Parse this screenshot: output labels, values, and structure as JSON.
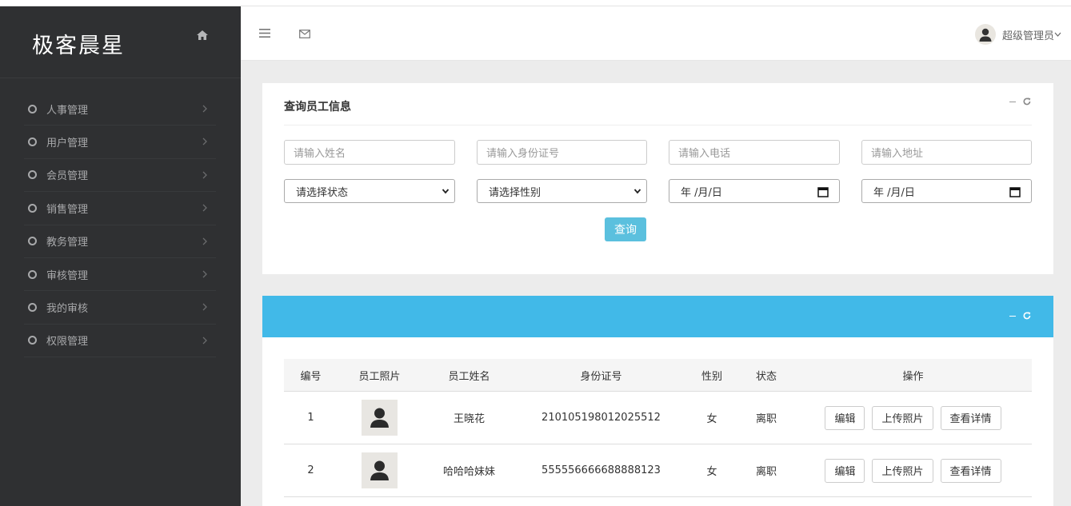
{
  "sidebar": {
    "logo": "极客晨星",
    "items": [
      {
        "label": "人事管理"
      },
      {
        "label": "用户管理"
      },
      {
        "label": "会员管理"
      },
      {
        "label": "销售管理"
      },
      {
        "label": "教务管理"
      },
      {
        "label": "审核管理"
      },
      {
        "label": "我的审核"
      },
      {
        "label": "权限管理"
      }
    ]
  },
  "header": {
    "user_name": "超级管理员",
    "icons": [
      "menu-icon",
      "mail-icon",
      "avatar-icon",
      "chevron-down-icon"
    ]
  },
  "search_card": {
    "title": "查询员工信息",
    "name_placeholder": "请输入姓名",
    "id_placeholder": "请输入身份证号",
    "phone_placeholder": "请输入电话",
    "address_placeholder": "请输入地址",
    "status_select": "请选择状态",
    "gender_select": "请选择性别",
    "date_from": "年 /月/日",
    "date_to": "年 /月/日",
    "query_button": "查询"
  },
  "table": {
    "headers": [
      "编号",
      "员工照片",
      "员工姓名",
      "身份证号",
      "性别",
      "状态",
      "操作"
    ],
    "rows": [
      {
        "id": "1",
        "name": "王晓花",
        "id_card": "210105198012025512",
        "gender": "女",
        "status": "离职"
      },
      {
        "id": "2",
        "name": "哈哈哈妹妹",
        "id_card": "555556666688888123",
        "gender": "女",
        "status": "离职"
      }
    ],
    "actions": {
      "edit": "编辑",
      "upload": "上传照片",
      "detail": "查看详情"
    }
  },
  "colors": {
    "sidebar_bg": "#2f3032",
    "accent_blue": "#41b9e8",
    "query_button": "#5bc0de",
    "page_bg": "#ececec"
  }
}
